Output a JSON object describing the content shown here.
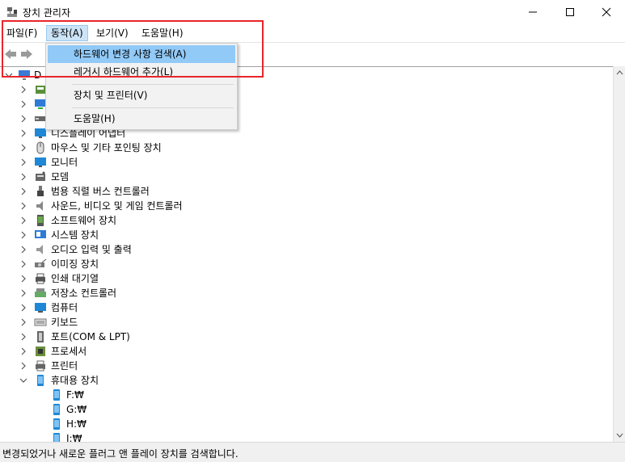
{
  "window": {
    "title": "장치 관리자",
    "minimize_icon": "minimize-icon",
    "maximize_icon": "maximize-icon",
    "close_icon": "close-icon"
  },
  "menu": {
    "items": [
      "파일(F)",
      "동작(A)",
      "보기(V)",
      "도움말(H)"
    ],
    "active_index": 1
  },
  "dropdown": {
    "items": [
      "하드웨어 변경 사항 검색(A)",
      "레거시 하드웨어 추가(L)",
      "장치 및 프린터(V)",
      "도움말(H)"
    ],
    "highlighted_index": 0
  },
  "tree": {
    "root_label": "D",
    "categories": [
      {
        "label": "",
        "icon": "audio-io-icon"
      },
      {
        "label": "",
        "icon": "network-icon"
      },
      {
        "label": "",
        "icon": "disk-icon"
      },
      {
        "label": "디스플레이 어댑터",
        "icon": "display-adapter-icon"
      },
      {
        "label": "마우스 및 기타 포인팅 장치",
        "icon": "mouse-icon"
      },
      {
        "label": "모니터",
        "icon": "monitor-icon"
      },
      {
        "label": "모뎀",
        "icon": "modem-icon"
      },
      {
        "label": "범용 직렬 버스 컨트롤러",
        "icon": "usb-icon"
      },
      {
        "label": "사운드, 비디오 및 게임 컨트롤러",
        "icon": "speaker-icon"
      },
      {
        "label": "소프트웨어 장치",
        "icon": "software-device-icon"
      },
      {
        "label": "시스템 장치",
        "icon": "system-device-icon"
      },
      {
        "label": "오디오 입력 및 출력",
        "icon": "audio-icon"
      },
      {
        "label": "이미징 장치",
        "icon": "camera-icon"
      },
      {
        "label": "인쇄 대기열",
        "icon": "print-queue-icon"
      },
      {
        "label": "저장소 컨트롤러",
        "icon": "storage-controller-icon"
      },
      {
        "label": "컴퓨터",
        "icon": "computer-icon"
      },
      {
        "label": "키보드",
        "icon": "keyboard-icon"
      },
      {
        "label": "포트(COM & LPT)",
        "icon": "port-icon"
      },
      {
        "label": "프로세서",
        "icon": "processor-icon"
      },
      {
        "label": "프린터",
        "icon": "printer-icon"
      },
      {
        "label": "휴대용 장치",
        "icon": "portable-device-icon"
      }
    ],
    "portable_children": [
      "F:₩",
      "G:₩",
      "H:₩",
      "I:₩"
    ]
  },
  "status": {
    "text": "변경되었거나 새로운 플러그 앤 플레이 장치를 검색합니다."
  },
  "colors": {
    "highlight": "#91c9f7",
    "active_menu": "#cce4f7",
    "annotation_box": "#e8262b"
  }
}
